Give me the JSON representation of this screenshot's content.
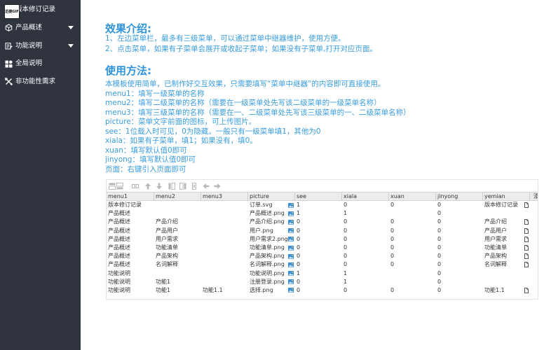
{
  "watermark": {
    "text": "迅捷GIF"
  },
  "colors": {
    "sidebar_background": "#30343f",
    "sidebar_text": "#ffffff",
    "heading": "#2e93d9",
    "body_text": "#3a9de0"
  },
  "sidebar": {
    "items": [
      {
        "label": "版本修订记录",
        "icon": "document-icon",
        "has_submenu": false
      },
      {
        "label": "产品概述",
        "icon": "cube-icon",
        "has_submenu": true
      },
      {
        "label": "功能说明",
        "icon": "function-doc-icon",
        "has_submenu": true
      },
      {
        "label": "全局说明",
        "icon": "apps-grid-icon",
        "has_submenu": false
      },
      {
        "label": "非功能性需求",
        "icon": "tools-icon",
        "has_submenu": false
      }
    ]
  },
  "intro": {
    "title": "效果介绍:",
    "lines": [
      "1、左边菜单栏，最多有三级菜单，可以通过菜单中继器维护，使用方便。",
      "2、点击菜单，如果有子菜单会展开或收起子菜单；如果没有子菜单,打开对应页面。"
    ]
  },
  "usage": {
    "title": "使用方法:",
    "lines": [
      "本模板使用简单，已制作好交互效果，只需要填写“菜单中继器”的内容即可直接使用。",
      "menu1：填写一级菜单的名称",
      "menu2：填写二级菜单的名称（需要在一级菜单处先写该二级菜单的一级菜单名称）",
      "menu3：填写三级菜单的名称（需要在一、二级菜单处先写该三级菜单的一、二级菜单名称）",
      "picture：菜单文字前面的图标，可上传图片。",
      "see：1位载入时可见，0为隐藏。一般只有一级菜单填1，其他为0",
      "xiala：如果有子菜单，填1；如果没有，填0。",
      "xuan：填写默认值0即可",
      "jinyong：填写默认值0即可",
      "页面：右键引入页面即可"
    ]
  },
  "repeater": {
    "toolbar_icons": [
      "add-row-above-icon",
      "add-row-below-icon",
      "delete-row-icon",
      "move-up-icon",
      "move-down-icon",
      "add-column-left-icon",
      "add-column-right-icon",
      "delete-column-icon",
      "move-left-icon",
      "move-right-icon"
    ],
    "columns": [
      "menu1",
      "menu2",
      "menu3",
      "picture",
      "see",
      "xiala",
      "xuan",
      "jinyong",
      "yemian",
      "添"
    ],
    "rows": [
      [
        "版本修订记录",
        "",
        "",
        "订单.svg",
        "1",
        "0",
        "0",
        "0",
        "版本修订记录"
      ],
      [
        "产品概述",
        "",
        "",
        "产品概述.png",
        "1",
        "1",
        "",
        "0",
        ""
      ],
      [
        "产品概述",
        "产品介绍",
        "",
        "产品介绍.png",
        "0",
        "0",
        "0",
        "0",
        "产品介绍"
      ],
      [
        "产品概述",
        "产品用户",
        "",
        "用户.png",
        "0",
        "0",
        "0",
        "0",
        "产品用户"
      ],
      [
        "产品概述",
        "用户需求",
        "",
        "用户需求2.png",
        "0",
        "0",
        "0",
        "0",
        "用户需求"
      ],
      [
        "产品概述",
        "功能清单",
        "",
        "功能清单.png",
        "0",
        "0",
        "0",
        "0",
        "功能清单"
      ],
      [
        "产品概述",
        "产品架构",
        "",
        "产品架构.png",
        "0",
        "0",
        "0",
        "0",
        "产品架构"
      ],
      [
        "产品概述",
        "名词解释",
        "",
        "名词解释.png",
        "0",
        "0",
        "0",
        "0",
        "名词解释"
      ],
      [
        "功能说明",
        "",
        "",
        "功能说明.png",
        "1",
        "1",
        "",
        "0",
        ""
      ],
      [
        "功能说明",
        "功能1",
        "",
        "注册登录.png",
        "0",
        "1",
        "",
        "0",
        ""
      ],
      [
        "功能说明",
        "功能1",
        "功能1.1",
        "选择.png",
        "0",
        "0",
        "0",
        "0",
        "功能1.1"
      ]
    ]
  }
}
